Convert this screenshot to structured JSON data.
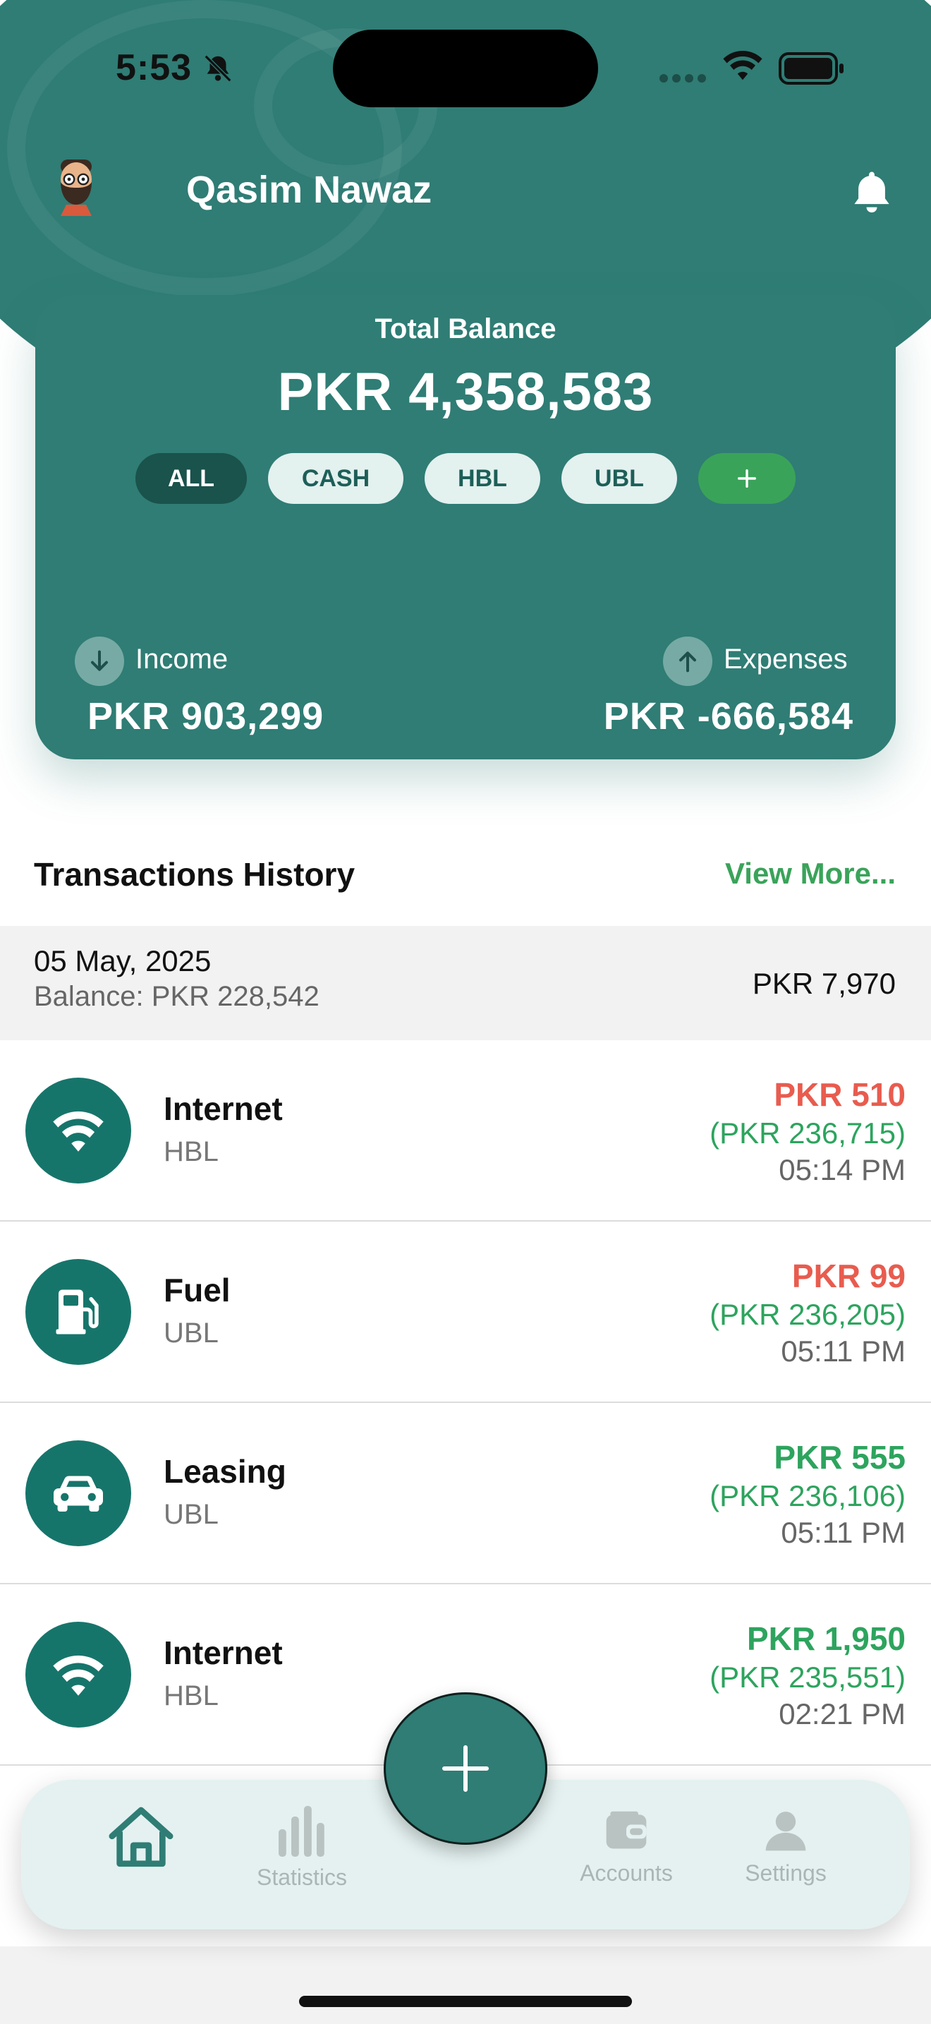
{
  "status_bar": {
    "time": "5:53"
  },
  "header": {
    "user_name": "Qasim Nawaz"
  },
  "balance": {
    "label": "Total Balance",
    "amount": "PKR 4,358,583",
    "accounts": [
      "ALL",
      "CASH",
      "HBL",
      "UBL"
    ],
    "active_account": "ALL",
    "income_label": "Income",
    "income_amount": "PKR 903,299",
    "expense_label": "Expenses",
    "expense_amount": "PKR -666,584"
  },
  "transactions": {
    "title": "Transactions History",
    "view_more": "View More...",
    "day": {
      "date": "05 May, 2025",
      "balance": "Balance: PKR 228,542",
      "total": "PKR 7,970"
    },
    "items": [
      {
        "icon": "wifi-icon",
        "name": "Internet",
        "account": "HBL",
        "amount": "PKR 510",
        "type": "expense",
        "running": "(PKR 236,715)",
        "time": "05:14 PM"
      },
      {
        "icon": "fuel-icon",
        "name": "Fuel",
        "account": "UBL",
        "amount": "PKR 99",
        "type": "expense",
        "running": "(PKR 236,205)",
        "time": "05:11 PM"
      },
      {
        "icon": "car-icon",
        "name": "Leasing",
        "account": "UBL",
        "amount": "PKR 555",
        "type": "income",
        "running": "(PKR 236,106)",
        "time": "05:11 PM"
      },
      {
        "icon": "wifi-icon",
        "name": "Internet",
        "account": "HBL",
        "amount": "PKR 1,950",
        "type": "income",
        "running": "(PKR 235,551)",
        "time": "02:21 PM"
      }
    ]
  },
  "nav": {
    "items": [
      {
        "icon": "home-icon",
        "label": ""
      },
      {
        "icon": "bar-chart-icon",
        "label": "Statistics"
      },
      {
        "icon": "wallet-icon",
        "label": "Accounts"
      },
      {
        "icon": "person-icon",
        "label": "Settings"
      }
    ],
    "active": "home"
  },
  "colors": {
    "primary": "#2f7d75",
    "primary_dark": "#1a524c",
    "accent_green": "#3aa35a",
    "expense_red": "#e85c4f",
    "icon_teal": "#16756b"
  }
}
